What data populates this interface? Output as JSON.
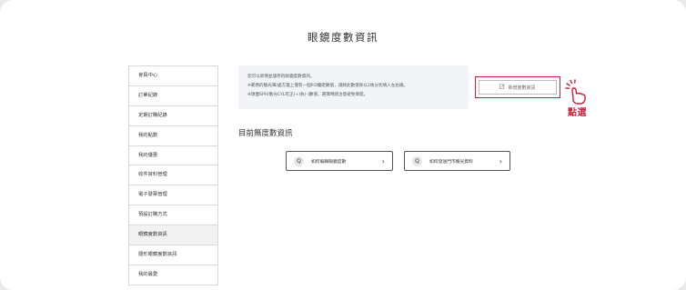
{
  "page": {
    "title": "眼鏡度數資訊"
  },
  "sidebar": {
    "items": [
      {
        "label": "會員中心"
      },
      {
        "label": "訂單紀錄"
      },
      {
        "label": "定期訂購紀錄"
      },
      {
        "label": "我的點數"
      },
      {
        "label": "我的優惠"
      },
      {
        "label": "收件資料管理"
      },
      {
        "label": "電子發票管理"
      },
      {
        "label": "預設訂購方式"
      },
      {
        "label": "眼鏡度數資訊",
        "active": true
      },
      {
        "label": "隱形眼鏡度數資訊"
      },
      {
        "label": "我的最愛"
      }
    ]
  },
  "notice": {
    "lines": [
      "您可以新增並儲存的眼鏡度數資訊。",
      "※範例的驗光單/處方箋上僅有一個P.D瞳距數值，請將此數值除以2後分別填入左右眼。",
      "※球面SPH/散光CYL有正(+)負(-)數值，選擇時請注意避免填錯。"
    ]
  },
  "add_button": {
    "label": "新增度數資訊",
    "icon": "edit-icon"
  },
  "annotation": {
    "label": "點選",
    "color": "#c8203d"
  },
  "section": {
    "title": "目前無度數資訊"
  },
  "help_buttons": [
    {
      "label": "如何編輯眼鏡度數",
      "icon": "q-icon"
    },
    {
      "label": "如何發送門市驗光資料",
      "icon": "q-icon"
    }
  ]
}
